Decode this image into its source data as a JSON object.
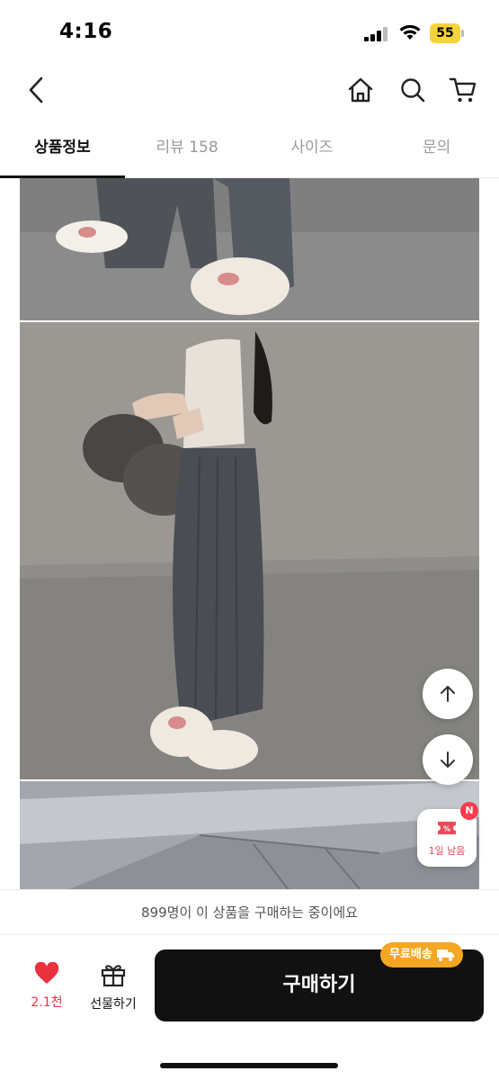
{
  "status_bar": {
    "time": "4:16",
    "battery": "55"
  },
  "top_nav": {
    "back_icon": "chevron-left-icon",
    "home_icon": "home-icon",
    "search_icon": "search-icon",
    "cart_icon": "cart-icon"
  },
  "tabs": [
    {
      "label": "상품정보",
      "active": true
    },
    {
      "label": "리뷰 158",
      "active": false
    },
    {
      "label": "사이즈",
      "active": false
    },
    {
      "label": "문의",
      "active": false
    }
  ],
  "floating": {
    "scroll_up_icon": "arrow-up-icon",
    "scroll_down_icon": "arrow-down-icon",
    "coupon_badge": "N",
    "coupon_text": "1일 남음"
  },
  "buying_banner": "899명이 이 상품을 구매하는 중이에요",
  "bottom_bar": {
    "like_count": "2.1천",
    "gift_label": "선물하기",
    "buy_label": "구매하기",
    "shipping_badge": "무료배송"
  },
  "colors": {
    "accent_red": "#e8333f",
    "shipping_orange": "#f5a623",
    "buy_button": "#111111"
  }
}
